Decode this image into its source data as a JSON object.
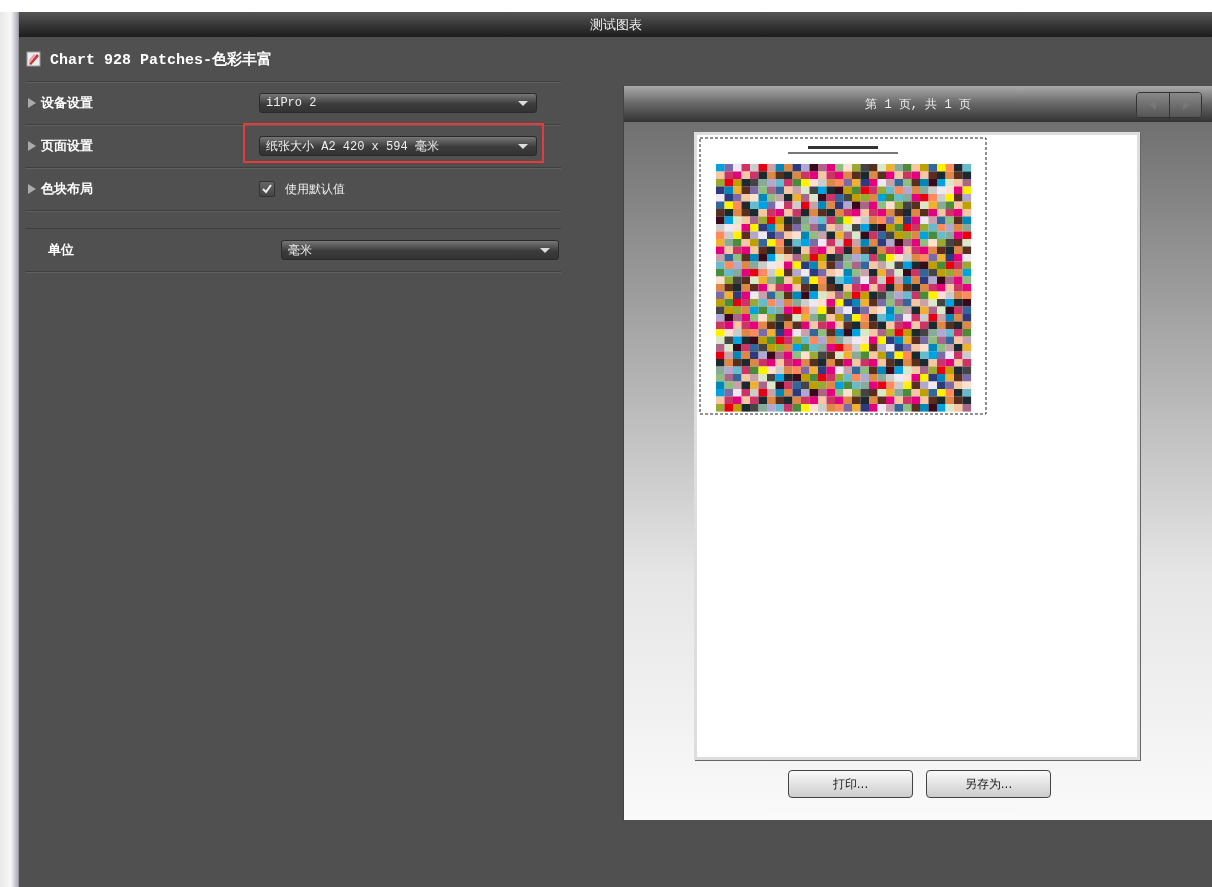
{
  "window": {
    "title": "测试图表"
  },
  "chart_title": "Chart 928 Patches-色彩丰富",
  "settings": [
    {
      "kind": "dropdown",
      "label": "设备设置",
      "expandable": true,
      "value": "i1Pro 2",
      "highlighted": false
    },
    {
      "kind": "dropdown",
      "label": "页面设置",
      "expandable": true,
      "value": "纸张大小 A2 420 x 594 毫米",
      "highlighted": true
    },
    {
      "kind": "checkbox",
      "label": "色块布局",
      "expandable": true,
      "value": "使用默认值",
      "checked": true,
      "highlighted": false
    },
    {
      "kind": "dropdown",
      "label": "单位",
      "expandable": false,
      "value": "毫米",
      "highlighted": false
    }
  ],
  "preview": {
    "page_indicator": "第 1 页, 共 1 页",
    "prev_disabled": true,
    "next_disabled": true
  },
  "buttons": [
    "打印...",
    "另存为..."
  ]
}
